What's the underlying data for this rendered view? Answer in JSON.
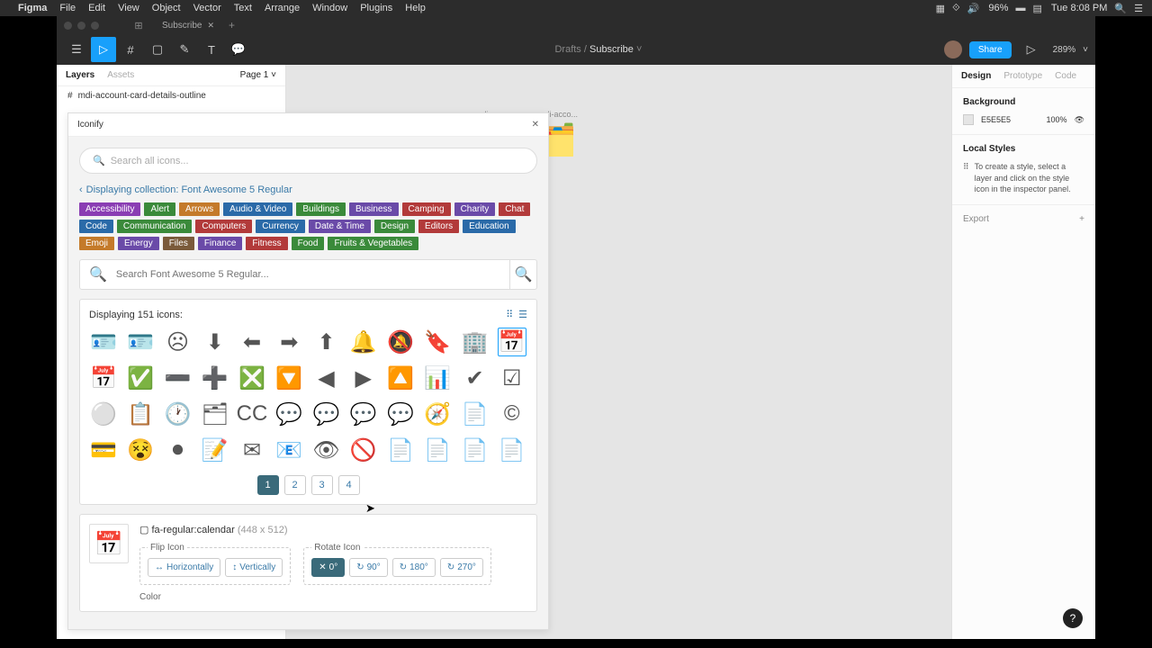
{
  "menubar": {
    "app": "Figma",
    "items": [
      "File",
      "Edit",
      "View",
      "Object",
      "Vector",
      "Text",
      "Arrange",
      "Window",
      "Plugins",
      "Help"
    ],
    "battery": "96%",
    "clock": "Tue 8:08 PM"
  },
  "tabs": {
    "name": "Subscribe"
  },
  "toolbar": {
    "breadcrumb_parent": "Drafts",
    "breadcrumb_doc": "Subscribe",
    "share": "Share",
    "zoom": "289%"
  },
  "left": {
    "tab_layers": "Layers",
    "tab_assets": "Assets",
    "page": "Page 1",
    "layer": "mdi-account-card-details-outline"
  },
  "right": {
    "tab_design": "Design",
    "tab_prototype": "Prototype",
    "tab_code": "Code",
    "bg_title": "Background",
    "bg_hex": "E5E5E5",
    "bg_opacity": "100%",
    "local_styles_title": "Local Styles",
    "local_styles_hint": "To create a style, select a layer and click on the style icon in the inspector panel.",
    "export": "Export"
  },
  "canvas": {
    "icon1_label": "mdi-acco...",
    "icon2_label": "mdi-acco..."
  },
  "iconify": {
    "title": "Iconify",
    "search_all_placeholder": "Search all icons...",
    "collection_label": "Displaying collection: Font Awesome 5 Regular",
    "tags": [
      {
        "t": "Accessibility",
        "c": "#8a3db3"
      },
      {
        "t": "Alert",
        "c": "#3a8a3a"
      },
      {
        "t": "Arrows",
        "c": "#c47a2a"
      },
      {
        "t": "Audio & Video",
        "c": "#2a6aa8"
      },
      {
        "t": "Buildings",
        "c": "#3a8a3a"
      },
      {
        "t": "Business",
        "c": "#6a4aa8"
      },
      {
        "t": "Camping",
        "c": "#b23a3a"
      },
      {
        "t": "Charity",
        "c": "#6a4aa8"
      },
      {
        "t": "Chat",
        "c": "#b23a3a"
      },
      {
        "t": "Code",
        "c": "#2a6aa8"
      },
      {
        "t": "Communication",
        "c": "#3a8a3a"
      },
      {
        "t": "Computers",
        "c": "#b23a3a"
      },
      {
        "t": "Currency",
        "c": "#2a6aa8"
      },
      {
        "t": "Date & Time",
        "c": "#6a4aa8"
      },
      {
        "t": "Design",
        "c": "#3a8a3a"
      },
      {
        "t": "Editors",
        "c": "#b23a3a"
      },
      {
        "t": "Education",
        "c": "#2a6aa8"
      },
      {
        "t": "Emoji",
        "c": "#c47a2a"
      },
      {
        "t": "Energy",
        "c": "#6a4aa8"
      },
      {
        "t": "Files",
        "c": "#7a5a3a"
      },
      {
        "t": "Finance",
        "c": "#6a4aa8"
      },
      {
        "t": "Fitness",
        "c": "#b23a3a"
      },
      {
        "t": "Food",
        "c": "#3a8a3a"
      },
      {
        "t": "Fruits & Vegetables",
        "c": "#3a8a3a"
      }
    ],
    "search_collection_placeholder": "Search Font Awesome 5 Regular...",
    "count_label": "Displaying 151 icons:",
    "pages": [
      "1",
      "2",
      "3",
      "4"
    ],
    "selected": {
      "name": "fa-regular:calendar",
      "dims": "(448 x 512)",
      "flip_title": "Flip Icon",
      "flip_h": "Horizontally",
      "flip_v": "Vertically",
      "rotate_title": "Rotate Icon",
      "rot_0": "0°",
      "rot_90": "90°",
      "rot_180": "180°",
      "rot_270": "270°",
      "color_title": "Color"
    }
  }
}
